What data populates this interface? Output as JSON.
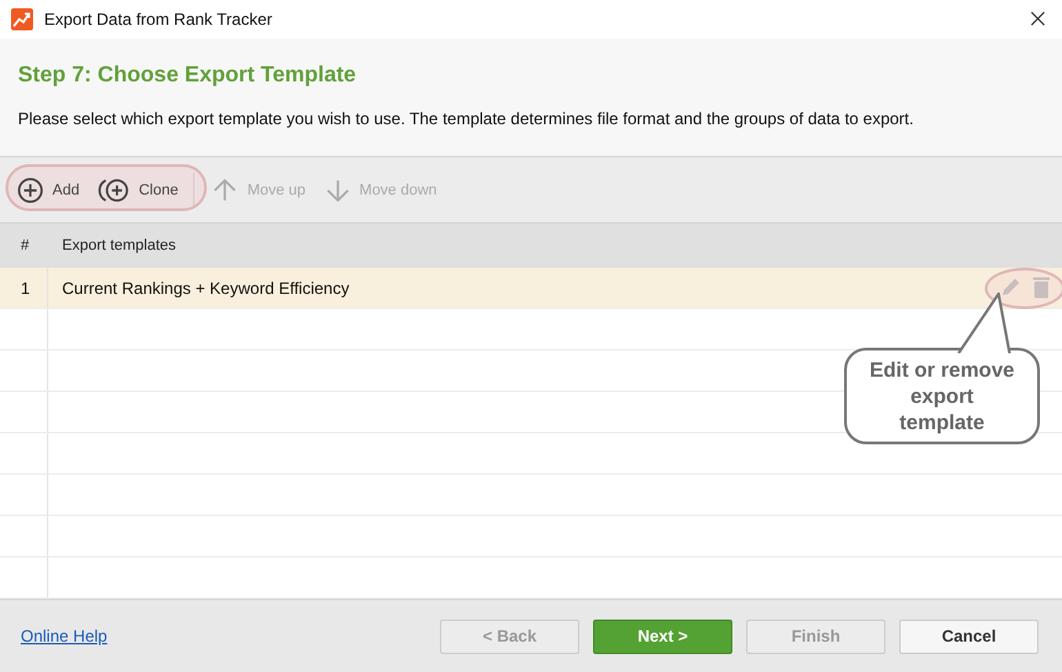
{
  "window": {
    "title": "Export Data from Rank Tracker"
  },
  "header": {
    "title": "Step 7: Choose Export Template",
    "description": "Please select which export template you wish to use. The template determines file format and the groups of data to export."
  },
  "toolbar": [
    {
      "kind": "add",
      "label": "Add",
      "disabled": false
    },
    {
      "kind": "clone",
      "label": "Clone",
      "disabled": false
    },
    {
      "kind": "up",
      "label": "Move up",
      "disabled": true
    },
    {
      "kind": "down",
      "label": "Move down",
      "disabled": true
    }
  ],
  "table": {
    "columns": [
      "#",
      "Export templates"
    ],
    "rows": [
      {
        "number": "1",
        "name": "Current Rankings + Keyword Efficiency",
        "selected": true
      }
    ]
  },
  "callout": {
    "text": "Edit or remove export template"
  },
  "footer": {
    "help_link": "Online Help",
    "buttons": [
      {
        "label": "< Back",
        "kind": "default",
        "disabled": true
      },
      {
        "label": "Next >",
        "kind": "primary",
        "disabled": false
      },
      {
        "label": "Finish",
        "kind": "default",
        "disabled": true
      },
      {
        "label": "Cancel",
        "kind": "default",
        "disabled": false
      }
    ]
  }
}
